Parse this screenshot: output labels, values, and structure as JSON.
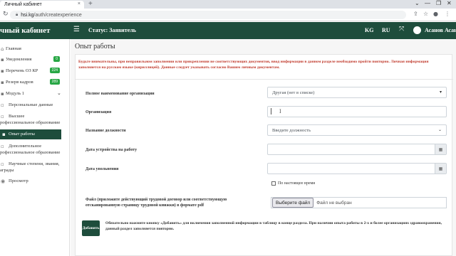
{
  "browser": {
    "tab_title": "Личный кабинет",
    "tab_close": "×",
    "new_tab": "+",
    "url_host": "hsi.kg",
    "url_path": "/auth/createxperience",
    "window_controls": [
      "⌄",
      "—",
      "❐",
      "✕"
    ]
  },
  "header": {
    "brand": "чный кабинет",
    "status": "Статус: Заявитель",
    "lang_kg": "KG",
    "lang_ru": "RU",
    "user_name": "Асанов Асан"
  },
  "sidebar": {
    "items": [
      {
        "label": "Главная"
      },
      {
        "label": "Уведомления",
        "badge": "0"
      },
      {
        "label": "Перечень ОЗ КР",
        "badge": "224"
      },
      {
        "label": "Резерв кадров",
        "badge": "289"
      },
      {
        "label": "Модуль 1"
      },
      {
        "label": "Персональные данные"
      },
      {
        "label_1": "Высшее",
        "label_2": "рофессиональное образование"
      },
      {
        "label": "Опыт работы"
      },
      {
        "label_1": "Дополнительное",
        "label_2": "рофессиональное образование"
      },
      {
        "label_1": "Научные степени, звания,",
        "label_2": "аграды"
      },
      {
        "label": "Просмотр"
      }
    ]
  },
  "main": {
    "page_title": "Опыт работы",
    "warning": "Будьте внимательны, при неправильном заполнении или прикреплении не соответствующих документов, ввод информации в данном разделе необходимо пройти повторно. Личная информация заполняется на русском языке (кириллицей). Данные следует указывать согласно Вашим личным документам.",
    "form": {
      "org_full_name_label": "Полное наименование организации",
      "org_full_name_value": "Другая (нет в списке)",
      "org_label": "Организация",
      "org_value": "",
      "position_label": "Название должности",
      "position_placeholder": "Введите должность",
      "start_date_label": "Дата устройства на работу",
      "end_date_label": "Дата увольнения",
      "current_checkbox_label": "По настоящее время",
      "file_label": "Файл (приложите действующий трудовой договор или соответствующую отсканированную страницу трудовой книжки) в формате pdf",
      "file_button": "Выберите файл",
      "file_status": "Файл не выбран",
      "add_button": "Добавить",
      "add_note": "Обязательно нажмите кнопку «Добавить» для включения заполненной информации в таблицу в конце раздела. При наличии опыта работы в 2-х и более организациях здравоохранения, данный раздел заполняется повторно."
    }
  },
  "colors": {
    "header_bg": "#1e4d3c",
    "badge_green": "#28a745",
    "warning_red": "#c0392b"
  }
}
